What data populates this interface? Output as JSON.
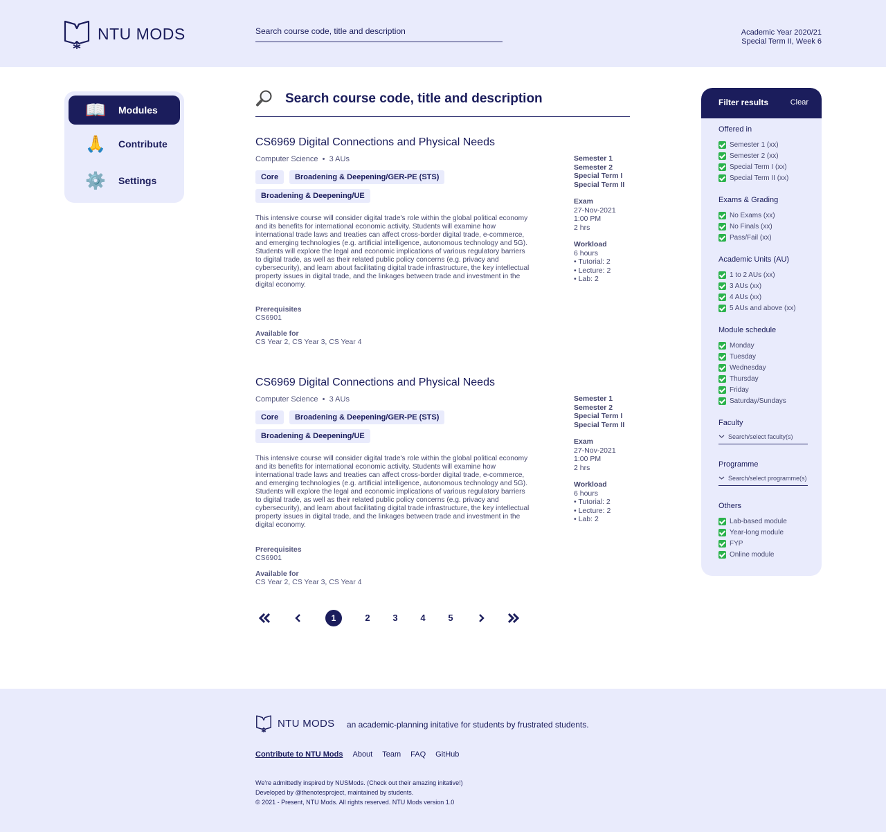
{
  "header": {
    "logo_text": "NTU MODS",
    "search_placeholder": "Search course code, title and description",
    "academic_year": "Academic Year 2020/21",
    "term_week": "Special Term II, Week 6"
  },
  "sidebar": {
    "items": [
      {
        "label": "Modules",
        "icon": "book-icon",
        "glyph": "📖"
      },
      {
        "label": "Contribute",
        "icon": "pray-icon",
        "glyph": "🙏"
      },
      {
        "label": "Settings",
        "icon": "gear-icon",
        "glyph": "⚙️"
      }
    ]
  },
  "main": {
    "search_title": "Search course code, title and description",
    "modules": [
      {
        "title": "CS6969 Digital Connections and Physical Needs",
        "faculty": "Computer Science",
        "aus": "3 AUs",
        "tags": [
          "Core",
          "Broadening & Deepening/GER-PE (STS)",
          "Broadening & Deepening/UE"
        ],
        "description": "This intensive course will consider digital trade's role within the global political economy and its benefits for international economic activity. Students will examine how international trade laws and treaties can affect cross-border digital trade, e-commerce, and emerging technologies (e.g. artificial intelligence, autonomous technology and 5G). Students will explore the legal and economic implications of various regulatory barriers to digital trade, as well as their related public policy concerns (e.g. privacy and cybersecurity), and learn about facilitating digital trade infrastructure, the key intellectual property issues in digital trade, and the linkages between trade and investment in the digital economy.",
        "prereq_label": "Prerequisites",
        "prereq": "CS6901",
        "available_label": "Available for",
        "available": "CS Year 2, CS Year 3, CS Year 4",
        "semesters": [
          "Semester 1",
          "Semester 2",
          "Special Term I",
          "Special Term II"
        ],
        "exam_label": "Exam",
        "exam_date": "27-Nov-2021",
        "exam_time": "1:00 PM",
        "exam_duration": "2 hrs",
        "workload_label": "Workload",
        "workload_hours": "6 hours",
        "workload_items": [
          "• Tutorial: 2",
          "• Lecture: 2",
          "• Lab: 2"
        ]
      },
      {
        "title": "CS6969 Digital Connections and Physical Needs",
        "faculty": "Computer Science",
        "aus": "3 AUs",
        "tags": [
          "Core",
          "Broadening & Deepening/GER-PE (STS)",
          "Broadening & Deepening/UE"
        ],
        "description": "This intensive course will consider digital trade's role within the global political economy and its benefits for international economic activity. Students will examine how international trade laws and treaties can affect cross-border digital trade, e-commerce, and emerging technologies (e.g. artificial intelligence, autonomous technology and 5G). Students will explore the legal and economic implications of various regulatory barriers to digital trade, as well as their related public policy concerns (e.g. privacy and cybersecurity), and learn about facilitating digital trade infrastructure, the key intellectual property issues in digital trade, and the linkages between trade and investment in the digital economy.",
        "prereq_label": "Prerequisites",
        "prereq": "CS6901",
        "available_label": "Available for",
        "available": "CS Year 2, CS Year 3, CS Year 4",
        "semesters": [
          "Semester 1",
          "Semester 2",
          "Special Term I",
          "Special Term II"
        ],
        "exam_label": "Exam",
        "exam_date": "27-Nov-2021",
        "exam_time": "1:00 PM",
        "exam_duration": "2 hrs",
        "workload_label": "Workload",
        "workload_hours": "6 hours",
        "workload_items": [
          "• Tutorial: 2",
          "• Lecture: 2",
          "• Lab: 2"
        ]
      }
    ],
    "pagination": {
      "pages": [
        "1",
        "2",
        "3",
        "4",
        "5"
      ],
      "current": "1"
    }
  },
  "filter": {
    "title": "Filter results",
    "clear": "Clear",
    "offered_in": {
      "label": "Offered in",
      "options": [
        "Semester 1 (xx)",
        "Semester 2 (xx)",
        "Special Term I (xx)",
        "Special Term II (xx)"
      ]
    },
    "exams": {
      "label": "Exams & Grading",
      "options": [
        "No Exams (xx)",
        "No Finals (xx)",
        "Pass/Fail (xx)"
      ]
    },
    "aus": {
      "label": "Academic Units (AU)",
      "options": [
        "1 to 2 AUs (xx)",
        "3 AUs (xx)",
        "4 AUs (xx)",
        "5 AUs and above (xx)"
      ]
    },
    "schedule": {
      "label": "Module schedule",
      "options": [
        "Monday",
        "Tuesday",
        "Wednesday",
        "Thursday",
        "Friday",
        "Saturday/Sundays"
      ]
    },
    "faculty": {
      "label": "Faculty",
      "placeholder": "Search/select faculty(s)"
    },
    "programme": {
      "label": "Programme",
      "placeholder": "Search/select programme(s)"
    },
    "others": {
      "label": "Others",
      "options": [
        "Lab-based module",
        "Year-long module",
        "FYP",
        "Online module"
      ]
    },
    "check_color": "#2bb24c"
  },
  "footer": {
    "logo_text": "NTU MODS",
    "tagline": "an academic-planning initative for students by frustrated students.",
    "links": [
      "Contribute to NTU Mods",
      "About",
      "Team",
      "FAQ",
      "GitHub"
    ],
    "note1": "We're admittedly inspired by NUSMods. (Check out their amazing initative!)",
    "note2": "Developed by @thenotesproject, maintained by students.",
    "note3": "© 2021 - Present, NTU Mods. All rights reserved. NTU Mods version 1.0"
  },
  "colors": {
    "primary": "#1b1d5c",
    "panel": "#e9ebfc",
    "check": "#2bb24c"
  }
}
